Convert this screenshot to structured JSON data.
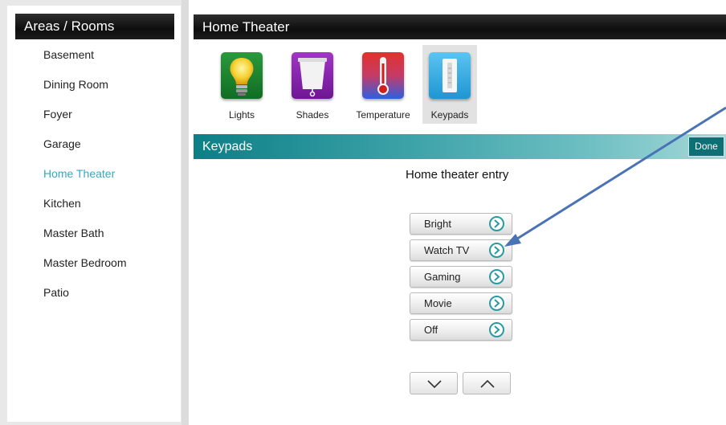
{
  "rooms_panel": {
    "title": "Areas / Rooms",
    "rooms": [
      {
        "label": "Basement"
      },
      {
        "label": "Dining Room"
      },
      {
        "label": "Foyer"
      },
      {
        "label": "Garage"
      },
      {
        "label": "Home Theater",
        "active": true
      },
      {
        "label": "Kitchen"
      },
      {
        "label": "Master Bath"
      },
      {
        "label": "Master Bedroom"
      },
      {
        "label": "Patio"
      }
    ]
  },
  "room_panel": {
    "title": "Home Theater",
    "categories": [
      {
        "label": "Lights",
        "icon": "lightbulb-icon"
      },
      {
        "label": "Shades",
        "icon": "shades-icon"
      },
      {
        "label": "Temperature",
        "icon": "thermometer-icon"
      },
      {
        "label": "Keypads",
        "icon": "keypad-icon",
        "selected": true
      }
    ],
    "section": {
      "title": "Keypads",
      "done_label": "Done"
    },
    "keypad": {
      "name": "Home theater entry",
      "scenes": [
        {
          "label": "Bright"
        },
        {
          "label": "Watch TV"
        },
        {
          "label": "Gaming"
        },
        {
          "label": "Movie"
        },
        {
          "label": "Off"
        }
      ]
    },
    "paging": {
      "down_icon": "chevron-down-icon",
      "up_icon": "chevron-up-icon"
    }
  },
  "colors": {
    "header_bg": "#111111",
    "active_room": "#3aa7c0",
    "section_bar": "#1e8f96",
    "scene_go": "#2a9aa2",
    "annotation_arrow": "#4a73b5"
  }
}
